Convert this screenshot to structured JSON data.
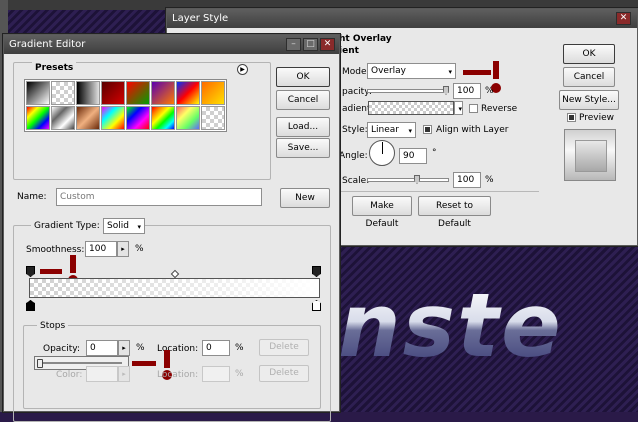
{
  "layer_style": {
    "title": "Layer Style",
    "section_title": "ht Overlay",
    "subsection_title": "ient",
    "blend_mode_label": "Mode:",
    "blend_mode_value": "Overlay",
    "opacity_label": "pacity:",
    "opacity_value": "100",
    "opacity_unit": "%",
    "gradient_label": "adient:",
    "reverse_label": "Reverse",
    "style_label": "Style:",
    "style_value": "Linear",
    "align_label": "Align with Layer",
    "angle_label": "Angle:",
    "angle_value": "90",
    "angle_unit": "°",
    "scale_label": "Scale:",
    "scale_value": "100",
    "scale_unit": "%",
    "make_default_label": "Make Default",
    "reset_default_label": "Reset to Default",
    "ok_label": "OK",
    "cancel_label": "Cancel",
    "new_style_label": "New Style...",
    "preview_label": "Preview",
    "preview_checked": true,
    "reverse_checked": false,
    "align_checked": true
  },
  "gradient_editor": {
    "title": "Gradient Editor",
    "presets_label": "Presets",
    "ok_label": "OK",
    "cancel_label": "Cancel",
    "load_label": "Load...",
    "save_label": "Save...",
    "name_label": "Name:",
    "name_value": "Custom",
    "new_label": "New",
    "gradient_type_label": "Gradient Type:",
    "gradient_type_value": "Solid",
    "smoothness_label": "Smoothness:",
    "smoothness_value": "100",
    "smoothness_unit": "%",
    "stops_label": "Stops",
    "opacity_label": "Opacity:",
    "opacity_value": "0",
    "opacity_unit": "%",
    "location_label": "Location:",
    "location_value": "0",
    "location_unit": "%",
    "delete_label": "Delete",
    "color_label": "Color:",
    "color_location_label": "Location:",
    "color_location_unit": "%",
    "color_delete_label": "Delete",
    "presets": [
      "black-white",
      "transparent-checker",
      "fg-to-transparent",
      "black-to-transparent",
      "red-green",
      "violet-orange",
      "blue-red-yellow",
      "orange-yellow",
      "rainbow-1",
      "chrome",
      "copper",
      "rainbow-2",
      "rainbow-3",
      "spectrum",
      "transparent-rainbow",
      "transparent-stripes"
    ]
  },
  "canvas": {
    "text": "nste"
  },
  "colors": {
    "marker": "#8b0000",
    "dialog_bg": "#e8e8e8",
    "titlebar": "#4a4a4a"
  }
}
